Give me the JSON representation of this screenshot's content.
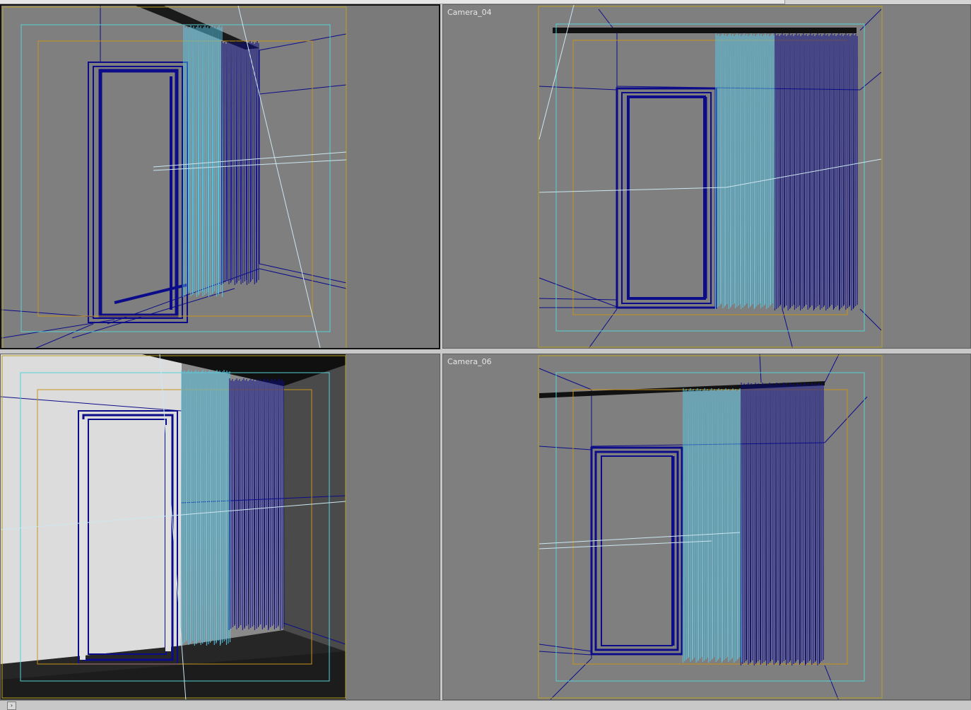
{
  "viewports": [
    {
      "id": "top-left",
      "label": ""
    },
    {
      "id": "top-right",
      "label": "Camera_04"
    },
    {
      "id": "bottom-left",
      "label": ""
    },
    {
      "id": "bottom-right",
      "label": "Camera_06"
    }
  ],
  "colors": {
    "viewport_bg": "#7f7f7f",
    "wire_dark": "#0c0c8a",
    "wire_light": "#58c6e6",
    "safe_frame_yellow": "#b9a222",
    "safe_frame_cyan": "#54d2d6",
    "safe_frame_orange": "#c8931a"
  },
  "bottom_bar": {
    "expand_icon": "chevron-right-icon",
    "expand_glyph": "›"
  }
}
